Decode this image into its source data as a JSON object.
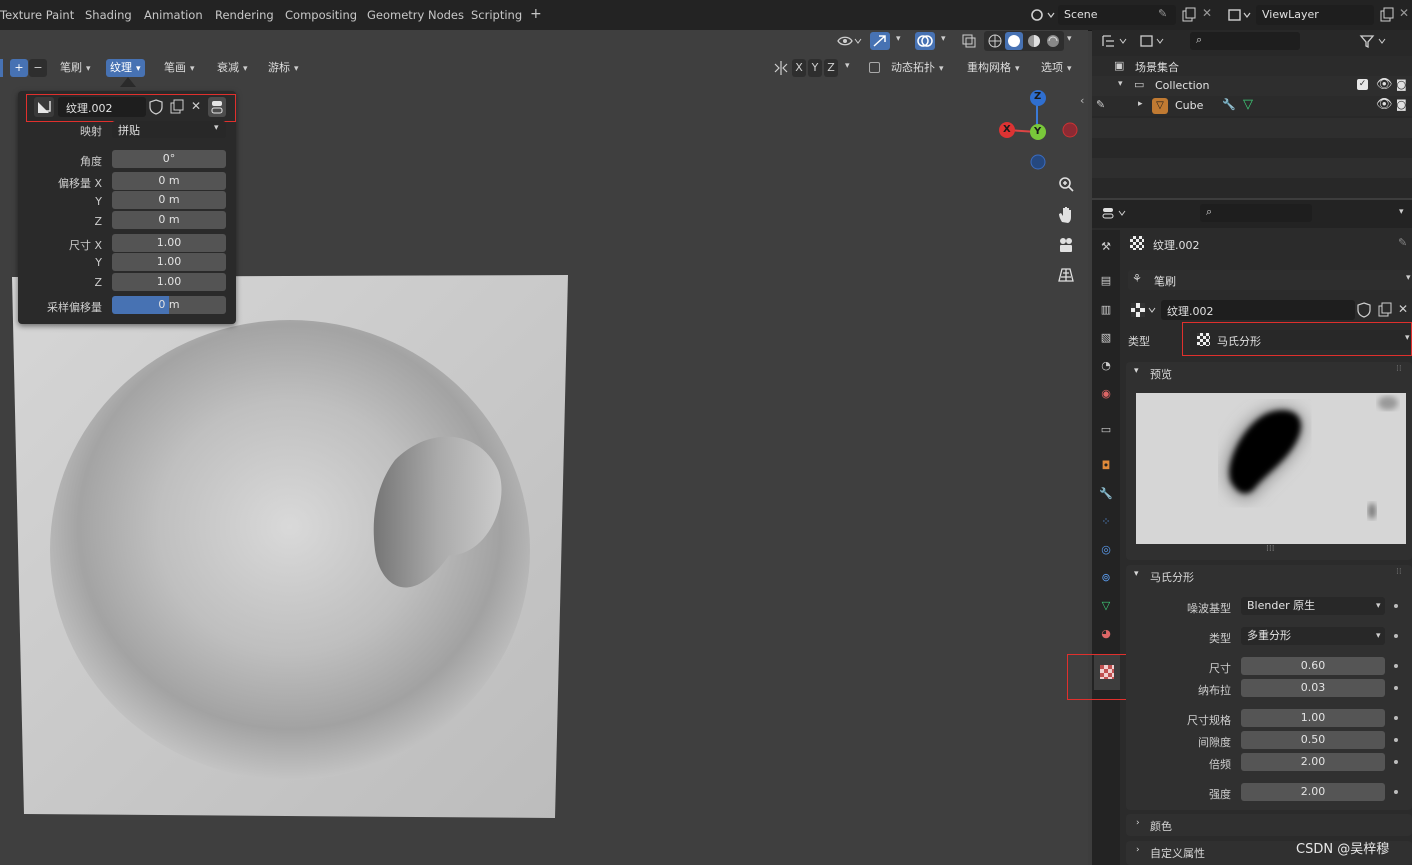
{
  "workspace_tabs": [
    "Texture Paint",
    "Shading",
    "Animation",
    "Rendering",
    "Compositing",
    "Geometry Nodes",
    "Scripting"
  ],
  "add_tab": "+",
  "scene": {
    "name": "Scene",
    "view_layer": "ViewLayer"
  },
  "viewport_header": {
    "brush": "笔刷",
    "texture": "纹理",
    "stroke": "笔画",
    "falloff": "衰减",
    "cursor": "游标",
    "axes": [
      "X",
      "Y",
      "Z"
    ],
    "dyntopo": "动态拓扑",
    "remesh": "重构网格",
    "options": "选项"
  },
  "texture_popup": {
    "texture_name": "纹理.002",
    "mapping_label": "映射",
    "mapping_value": "拼贴",
    "angle_label": "角度",
    "angle_value": "0°",
    "offset_label": "偏移量 X",
    "offset_x": "0 m",
    "offset_y_label": "Y",
    "offset_y": "0 m",
    "offset_z_label": "Z",
    "offset_z": "0 m",
    "size_label": "尺寸 X",
    "size_x": "1.00",
    "size_y_label": "Y",
    "size_y": "1.00",
    "size_z_label": "Z",
    "size_z": "1.00",
    "sample_bias_label": "采样偏移量",
    "sample_bias": "0 m"
  },
  "gizmo": {
    "x": "X",
    "y": "Y",
    "z": "Z"
  },
  "outliner": {
    "root": "场景集合",
    "collection": "Collection",
    "object": "Cube"
  },
  "properties": {
    "texture_name": "纹理.002",
    "context": "笔刷",
    "datablock": "纹理.002",
    "type_label": "类型",
    "type_value": "马氏分形",
    "preview_header": "预览",
    "musgrave_header": "马氏分形",
    "noise_basis_label": "噪波基型",
    "noise_basis_value": "Blender 原生",
    "fractal_type_label": "类型",
    "fractal_type_value": "多重分形",
    "size_label": "尺寸",
    "size_value": "0.60",
    "nabla_label": "纳布拉",
    "nabla_value": "0.03",
    "dimension_label": "尺寸规格",
    "dimension_value": "1.00",
    "lacunarity_label": "间隙度",
    "lacunarity_value": "0.50",
    "octaves_label": "倍频",
    "octaves_value": "2.00",
    "intensity_label": "强度",
    "intensity_value": "2.00",
    "colors_header": "颜色",
    "custom_props_header": "自定义属性"
  },
  "watermark": "CSDN @吴梓穆",
  "colors": {
    "accent_blue": "#4772b3",
    "highlight_red": "#e0302d",
    "texture_tab": "#c05050"
  },
  "icons": [
    "search-icon",
    "filter-icon",
    "eye-icon",
    "camera-icon",
    "zoom-icon",
    "hand-icon",
    "camera-view-icon",
    "grid-icon",
    "wrench-icon",
    "checker-icon"
  ]
}
